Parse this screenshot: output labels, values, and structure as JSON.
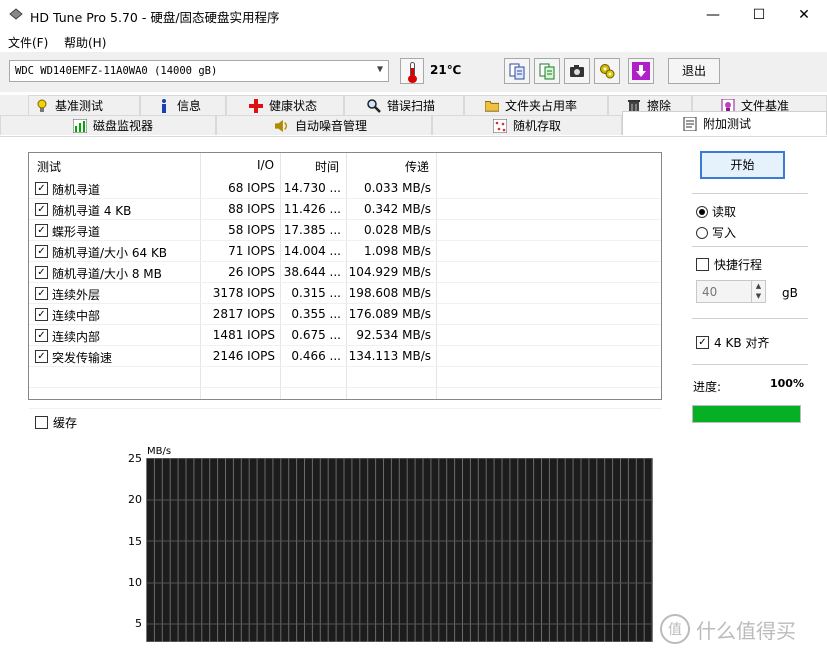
{
  "window": {
    "title": "HD Tune Pro 5.70 - 硬盘/固态硬盘实用程序",
    "minimize": "—",
    "maximize": "☐",
    "close": "✕"
  },
  "menu": {
    "file": "文件(F)",
    "help": "帮助(H)"
  },
  "toolbar": {
    "drive": "WDC WD140EMFZ-11A0WA0 (14000 gB)",
    "temperature": "21℃",
    "exit_label": "退出"
  },
  "tabs_row1": [
    {
      "label": "基准测试",
      "icon": "lightbulb-icon"
    },
    {
      "label": "信息",
      "icon": "info-icon"
    },
    {
      "label": "健康状态",
      "icon": "health-cross-icon"
    },
    {
      "label": "错误扫描",
      "icon": "magnifier-icon"
    },
    {
      "label": "文件夹占用率",
      "icon": "folder-icon"
    },
    {
      "label": "擦除",
      "icon": "trash-icon"
    },
    {
      "label": "文件基准",
      "icon": "file-benchmark-icon"
    }
  ],
  "tabs_row2": [
    {
      "label": "磁盘监视器",
      "icon": "bar-chart-icon"
    },
    {
      "label": "自动噪音管理",
      "icon": "speaker-icon"
    },
    {
      "label": "随机存取",
      "icon": "random-grid-icon"
    },
    {
      "label": "附加测试",
      "icon": "extra-test-icon",
      "active": true
    }
  ],
  "results": {
    "columns": [
      "测试",
      "I/O",
      "时间",
      "传递"
    ],
    "rows": [
      {
        "test": "随机寻道",
        "io": "68 IOPS",
        "time": "14.730 ...",
        "rate": "0.033 MB/s",
        "checked": true
      },
      {
        "test": "随机寻道 4 KB",
        "io": "88 IOPS",
        "time": "11.426 ...",
        "rate": "0.342 MB/s",
        "checked": true
      },
      {
        "test": "蝶形寻道",
        "io": "58 IOPS",
        "time": "17.385 ...",
        "rate": "0.028 MB/s",
        "checked": true
      },
      {
        "test": "随机寻道/大小 64 KB",
        "io": "71 IOPS",
        "time": "14.004 ...",
        "rate": "1.098 MB/s",
        "checked": true
      },
      {
        "test": "随机寻道/大小 8 MB",
        "io": "26 IOPS",
        "time": "38.644 ...",
        "rate": "104.929 MB/s",
        "checked": true
      },
      {
        "test": "连续外层",
        "io": "3178 IOPS",
        "time": "0.315 ...",
        "rate": "198.608 MB/s",
        "checked": true
      },
      {
        "test": "连续中部",
        "io": "2817 IOPS",
        "time": "0.355 ...",
        "rate": "176.089 MB/s",
        "checked": true
      },
      {
        "test": "连续内部",
        "io": "1481 IOPS",
        "time": "0.675 ...",
        "rate": "92.534 MB/s",
        "checked": true
      },
      {
        "test": "突发传输速",
        "io": "2146 IOPS",
        "time": "0.466 ...",
        "rate": "134.113 MB/s",
        "checked": true
      }
    ]
  },
  "cache": {
    "label": "缓存",
    "checked": false
  },
  "chart": {
    "unit": "MB/s",
    "y_ticks": [
      "25",
      "20",
      "15",
      "10",
      "5"
    ]
  },
  "controls": {
    "start_label": "开始",
    "read_label": "读取",
    "write_label": "写入",
    "mode": "read",
    "quick_label": "快捷行程",
    "quick_checked": false,
    "quick_value": "40",
    "quick_unit": "gB",
    "align_label": "4 KB 对齐",
    "align_checked": true,
    "progress_label": "进度:",
    "progress_text": "100%",
    "progress_fraction": 1.0,
    "progress_color": "#06b025"
  },
  "watermark": {
    "text": "什么值得买",
    "logo": "值"
  }
}
